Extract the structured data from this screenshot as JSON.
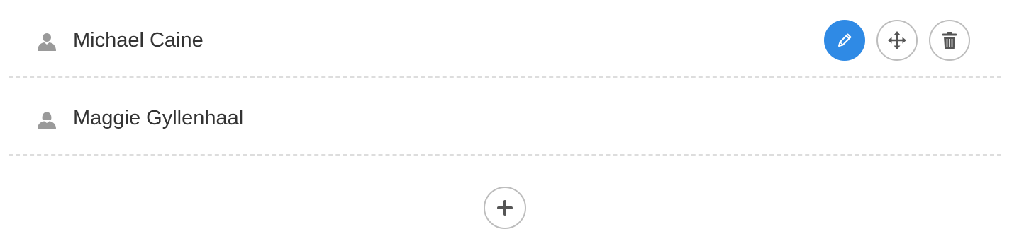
{
  "people": [
    {
      "name": "Michael Caine",
      "icon": "male-user-icon",
      "actions": [
        "edit-pencil-icon",
        "move-arrows-icon",
        "trash-icon"
      ]
    },
    {
      "name": "Maggie Gyllenhaal",
      "icon": "female-user-icon"
    }
  ],
  "add_button": {
    "icon": "plus-icon"
  },
  "colors": {
    "accent": "#2f8ae5",
    "text": "#333333",
    "icon_gray": "#9a9a9a",
    "border_gray": "#bdbdbd",
    "divider": "#dddddd"
  }
}
